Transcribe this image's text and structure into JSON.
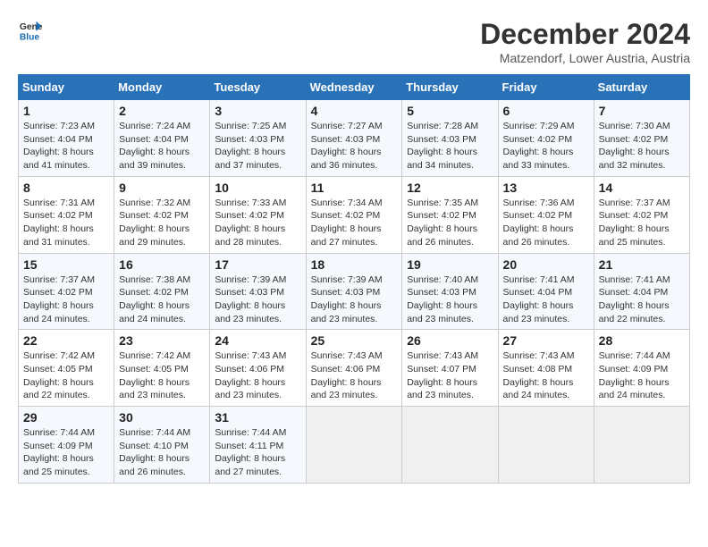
{
  "logo": {
    "line1": "General",
    "line2": "Blue"
  },
  "title": "December 2024",
  "subtitle": "Matzendorf, Lower Austria, Austria",
  "days_of_week": [
    "Sunday",
    "Monday",
    "Tuesday",
    "Wednesday",
    "Thursday",
    "Friday",
    "Saturday"
  ],
  "weeks": [
    [
      {
        "day": 1,
        "info": "Sunrise: 7:23 AM\nSunset: 4:04 PM\nDaylight: 8 hours and 41 minutes."
      },
      {
        "day": 2,
        "info": "Sunrise: 7:24 AM\nSunset: 4:04 PM\nDaylight: 8 hours and 39 minutes."
      },
      {
        "day": 3,
        "info": "Sunrise: 7:25 AM\nSunset: 4:03 PM\nDaylight: 8 hours and 37 minutes."
      },
      {
        "day": 4,
        "info": "Sunrise: 7:27 AM\nSunset: 4:03 PM\nDaylight: 8 hours and 36 minutes."
      },
      {
        "day": 5,
        "info": "Sunrise: 7:28 AM\nSunset: 4:03 PM\nDaylight: 8 hours and 34 minutes."
      },
      {
        "day": 6,
        "info": "Sunrise: 7:29 AM\nSunset: 4:02 PM\nDaylight: 8 hours and 33 minutes."
      },
      {
        "day": 7,
        "info": "Sunrise: 7:30 AM\nSunset: 4:02 PM\nDaylight: 8 hours and 32 minutes."
      }
    ],
    [
      {
        "day": 8,
        "info": "Sunrise: 7:31 AM\nSunset: 4:02 PM\nDaylight: 8 hours and 31 minutes."
      },
      {
        "day": 9,
        "info": "Sunrise: 7:32 AM\nSunset: 4:02 PM\nDaylight: 8 hours and 29 minutes."
      },
      {
        "day": 10,
        "info": "Sunrise: 7:33 AM\nSunset: 4:02 PM\nDaylight: 8 hours and 28 minutes."
      },
      {
        "day": 11,
        "info": "Sunrise: 7:34 AM\nSunset: 4:02 PM\nDaylight: 8 hours and 27 minutes."
      },
      {
        "day": 12,
        "info": "Sunrise: 7:35 AM\nSunset: 4:02 PM\nDaylight: 8 hours and 26 minutes."
      },
      {
        "day": 13,
        "info": "Sunrise: 7:36 AM\nSunset: 4:02 PM\nDaylight: 8 hours and 26 minutes."
      },
      {
        "day": 14,
        "info": "Sunrise: 7:37 AM\nSunset: 4:02 PM\nDaylight: 8 hours and 25 minutes."
      }
    ],
    [
      {
        "day": 15,
        "info": "Sunrise: 7:37 AM\nSunset: 4:02 PM\nDaylight: 8 hours and 24 minutes."
      },
      {
        "day": 16,
        "info": "Sunrise: 7:38 AM\nSunset: 4:02 PM\nDaylight: 8 hours and 24 minutes."
      },
      {
        "day": 17,
        "info": "Sunrise: 7:39 AM\nSunset: 4:03 PM\nDaylight: 8 hours and 23 minutes."
      },
      {
        "day": 18,
        "info": "Sunrise: 7:39 AM\nSunset: 4:03 PM\nDaylight: 8 hours and 23 minutes."
      },
      {
        "day": 19,
        "info": "Sunrise: 7:40 AM\nSunset: 4:03 PM\nDaylight: 8 hours and 23 minutes."
      },
      {
        "day": 20,
        "info": "Sunrise: 7:41 AM\nSunset: 4:04 PM\nDaylight: 8 hours and 23 minutes."
      },
      {
        "day": 21,
        "info": "Sunrise: 7:41 AM\nSunset: 4:04 PM\nDaylight: 8 hours and 22 minutes."
      }
    ],
    [
      {
        "day": 22,
        "info": "Sunrise: 7:42 AM\nSunset: 4:05 PM\nDaylight: 8 hours and 22 minutes."
      },
      {
        "day": 23,
        "info": "Sunrise: 7:42 AM\nSunset: 4:05 PM\nDaylight: 8 hours and 23 minutes."
      },
      {
        "day": 24,
        "info": "Sunrise: 7:43 AM\nSunset: 4:06 PM\nDaylight: 8 hours and 23 minutes."
      },
      {
        "day": 25,
        "info": "Sunrise: 7:43 AM\nSunset: 4:06 PM\nDaylight: 8 hours and 23 minutes."
      },
      {
        "day": 26,
        "info": "Sunrise: 7:43 AM\nSunset: 4:07 PM\nDaylight: 8 hours and 23 minutes."
      },
      {
        "day": 27,
        "info": "Sunrise: 7:43 AM\nSunset: 4:08 PM\nDaylight: 8 hours and 24 minutes."
      },
      {
        "day": 28,
        "info": "Sunrise: 7:44 AM\nSunset: 4:09 PM\nDaylight: 8 hours and 24 minutes."
      }
    ],
    [
      {
        "day": 29,
        "info": "Sunrise: 7:44 AM\nSunset: 4:09 PM\nDaylight: 8 hours and 25 minutes."
      },
      {
        "day": 30,
        "info": "Sunrise: 7:44 AM\nSunset: 4:10 PM\nDaylight: 8 hours and 26 minutes."
      },
      {
        "day": 31,
        "info": "Sunrise: 7:44 AM\nSunset: 4:11 PM\nDaylight: 8 hours and 27 minutes."
      },
      null,
      null,
      null,
      null
    ]
  ]
}
